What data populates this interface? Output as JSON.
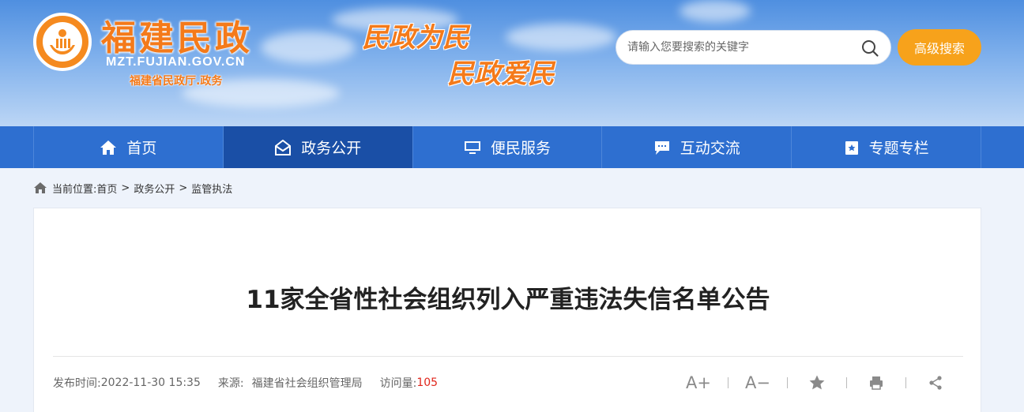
{
  "header": {
    "site_title": "福建民政",
    "domain": "MZT.FUJIAN.GOV.CN",
    "subtitle": "福建省民政厅.政务",
    "slogan_1": "民政为民",
    "slogan_2": "民政爱民",
    "search": {
      "placeholder": "请输入您要搜索的关键字"
    },
    "advanced_search_label": "高级搜索",
    "brand_color": "#f47a1a",
    "accent_color": "#f7a21b"
  },
  "nav": {
    "items": [
      {
        "label": "首页",
        "icon": "home-icon"
      },
      {
        "label": "政务公开",
        "icon": "mail-open-icon",
        "active": true
      },
      {
        "label": "便民服务",
        "icon": "monitor-icon"
      },
      {
        "label": "互动交流",
        "icon": "chat-icon"
      },
      {
        "label": "专题专栏",
        "icon": "bookmark-icon"
      }
    ],
    "color": "#2e6fd0",
    "active_color": "#1a4fa6"
  },
  "breadcrumb": {
    "prefix": "当前位置:",
    "items": [
      "首页",
      "政务公开",
      "监管执法"
    ],
    "separator": ">"
  },
  "article": {
    "title": "11家全省性社会组织列入严重违法失信名单公告",
    "publish_label": "发布时间:",
    "publish_time": "2022-11-30 15:35",
    "source_label": "来源:",
    "source": "福建省社会组织管理局",
    "views_label": "访问量:",
    "views": "105"
  },
  "tools": {
    "font_increase": "A+",
    "font_decrease": "A−",
    "icons": [
      "font-increase-icon",
      "font-decrease-icon",
      "star-icon",
      "print-icon",
      "share-icon"
    ]
  }
}
